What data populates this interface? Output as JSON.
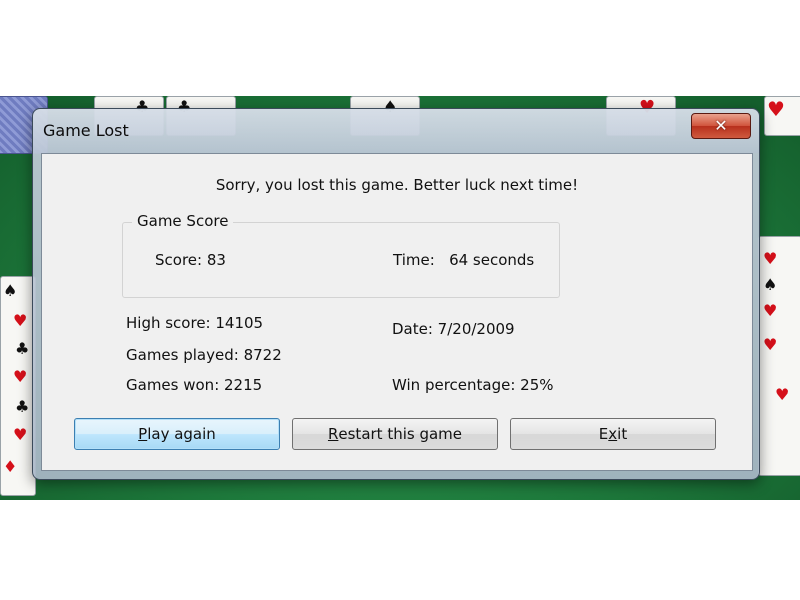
{
  "dialog": {
    "title": "Game Lost",
    "close_label": "✕",
    "message": "Sorry, you lost this game. Better luck next time!"
  },
  "game_score": {
    "label": "Game Score",
    "score": "Score: 83",
    "time": "Time:   64 seconds"
  },
  "stats": {
    "high_score": "High score: 14105",
    "games_played": "Games played: 8722",
    "games_won": "Games won: 2215",
    "date": "Date: 7/20/2009",
    "win_percentage": "Win percentage: 25%"
  },
  "buttons": {
    "play_again": {
      "key": "P",
      "rest": "lay again"
    },
    "restart": {
      "key": "R",
      "rest": "estart this game"
    },
    "exit": {
      "pre": "E",
      "key": "x",
      "rest": "it"
    }
  },
  "colors": {
    "felt": "#1f7b3d",
    "dialog_frame": "#b4c2d4",
    "close_button": "#c8452d",
    "default_button": "#bee6fd"
  },
  "icons": {
    "close": "close-icon",
    "suits": [
      "spade-icon",
      "club-icon",
      "heart-icon",
      "diamond-icon"
    ]
  }
}
